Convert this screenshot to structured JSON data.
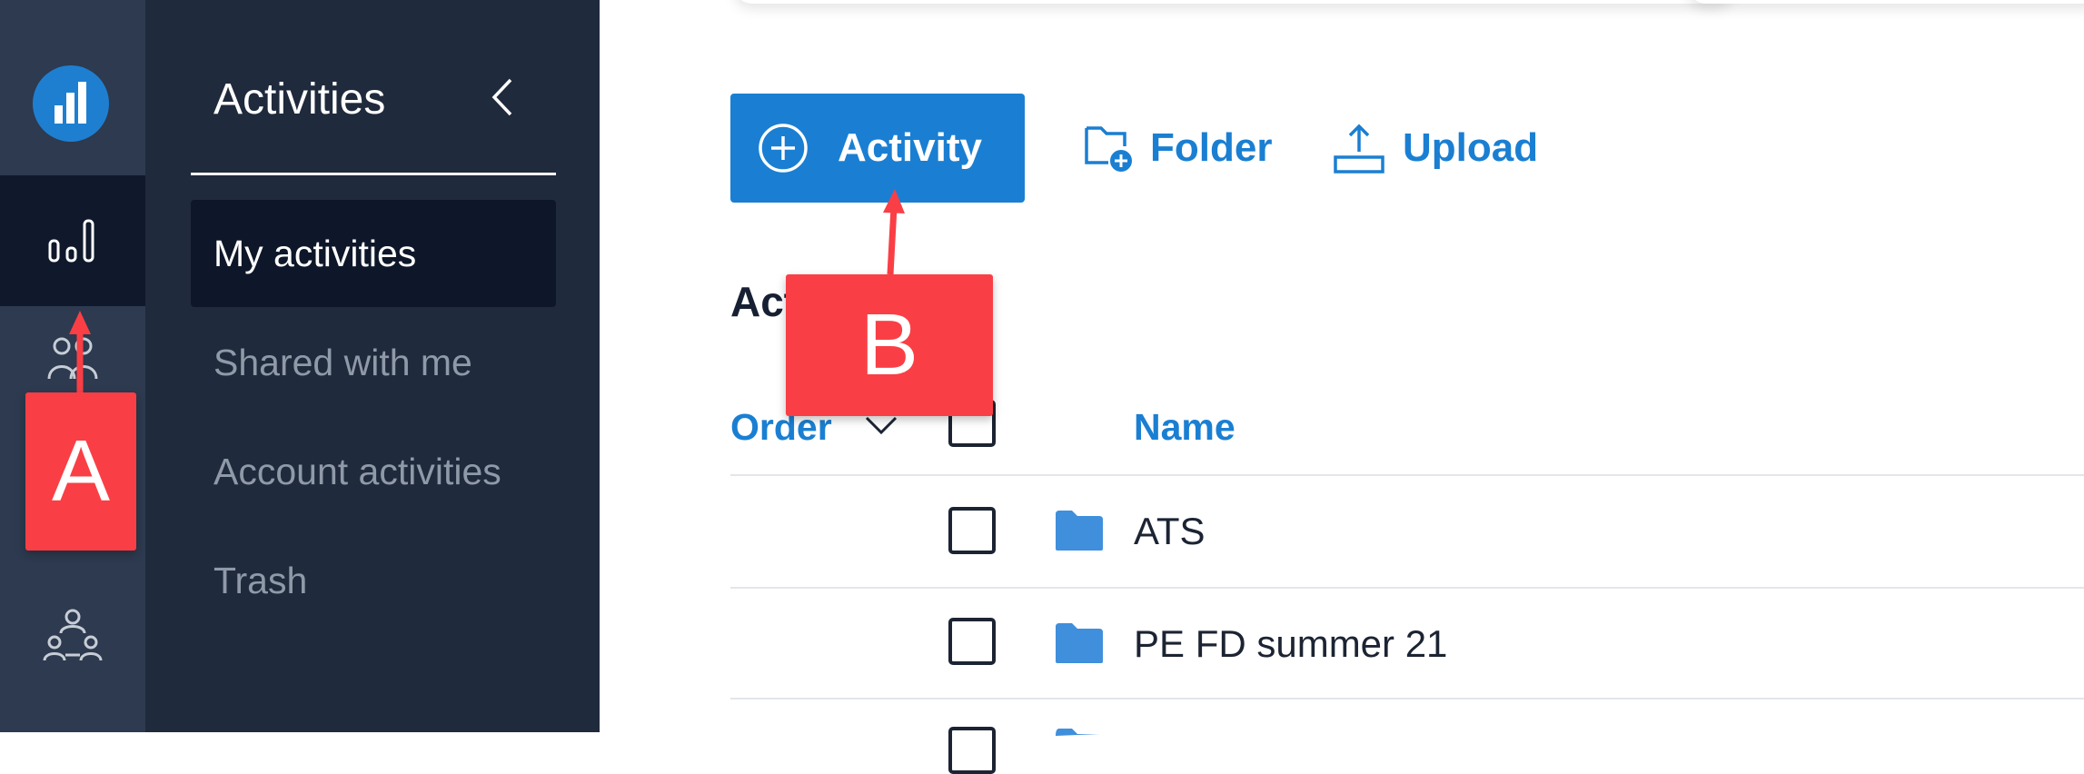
{
  "sidebar": {
    "title": "Activities",
    "items": [
      {
        "label": "My activities",
        "active": true
      },
      {
        "label": "Shared with me",
        "active": false
      },
      {
        "label": "Account activities",
        "active": false
      },
      {
        "label": "Trash",
        "active": false
      }
    ]
  },
  "rail": {
    "logo_icon": "chart-logo-icon",
    "items": [
      "bar-chart-icon",
      "people-icon",
      "team-icon"
    ]
  },
  "toolbar": {
    "activity_label": "Activity",
    "folder_label": "Folder",
    "upload_label": "Upload"
  },
  "section": {
    "heading": "Act"
  },
  "table": {
    "columns": {
      "order": "Order",
      "name": "Name"
    },
    "rows": [
      {
        "name": "ATS",
        "icon": "folder-icon"
      },
      {
        "name": "PE FD summer 21",
        "icon": "folder-icon"
      }
    ]
  },
  "annotations": {
    "a": "A",
    "b": "B"
  },
  "colors": {
    "accent": "#1a7fd2",
    "rail_bg": "#2d3a4f",
    "nav_bg": "#1f2a3c",
    "callout": "#f93f45"
  }
}
